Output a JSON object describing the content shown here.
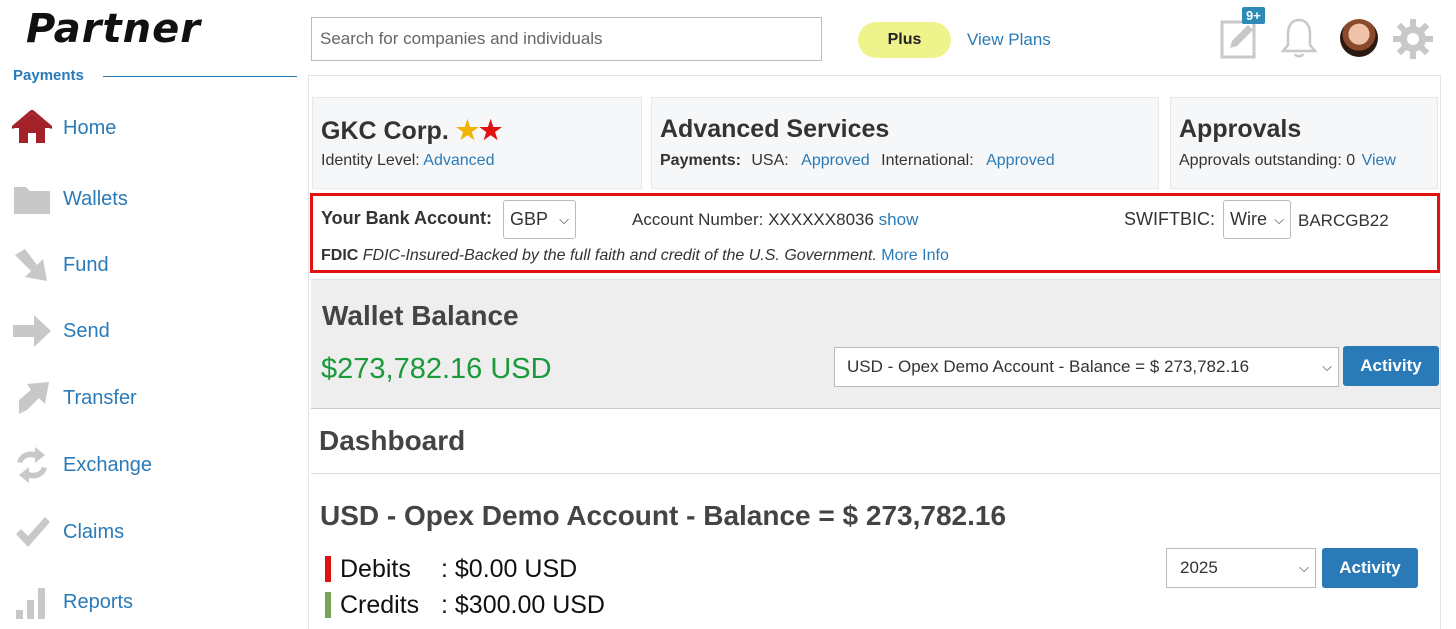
{
  "brand": {
    "logo_text": "Partner"
  },
  "sidebar": {
    "section_label": "Payments",
    "items": [
      {
        "label": "Home",
        "icon": "home-icon"
      },
      {
        "label": "Wallets",
        "icon": "folder-icon"
      },
      {
        "label": "Fund",
        "icon": "arrow-down-right-icon"
      },
      {
        "label": "Send",
        "icon": "arrow-right-icon"
      },
      {
        "label": "Transfer",
        "icon": "arrow-up-right-icon"
      },
      {
        "label": "Exchange",
        "icon": "exchange-icon"
      },
      {
        "label": "Claims",
        "icon": "checkmark-icon"
      },
      {
        "label": "Reports",
        "icon": "bar-chart-icon"
      }
    ]
  },
  "header": {
    "search_placeholder": "Search for companies and individuals",
    "plus_label": "Plus",
    "view_plans_label": "View Plans",
    "notes_badge": "9+"
  },
  "company_card": {
    "name": "GKC Corp.",
    "identity_label": "Identity Level:",
    "identity_value": "Advanced"
  },
  "services_card": {
    "title": "Advanced Services",
    "payments_label": "Payments:",
    "usa_label": "USA:",
    "usa_value": "Approved",
    "intl_label": "International:",
    "intl_value": "Approved"
  },
  "approvals_card": {
    "title": "Approvals",
    "outstanding_label": "Approvals outstanding: 0",
    "view_label": "View"
  },
  "bank_account": {
    "label": "Your Bank Account:",
    "currency": "GBP",
    "account_number_label": "Account Number:",
    "account_number": "XXXXXX8036",
    "show_label": "show",
    "swift_label": "SWIFTBIC:",
    "transfer_type": "Wire",
    "swift_code": "BARCGB22",
    "fdic_label": "FDIC",
    "fdic_text": "FDIC-Insured-Backed by the full faith and credit of the U.S. Government.",
    "more_info_label": "More Info"
  },
  "wallet_balance": {
    "title": "Wallet Balance",
    "amount": "$273,782.16 USD",
    "account_select": "USD - Opex Demo Account - Balance = $ 273,782.16",
    "activity_label": "Activity"
  },
  "dashboard": {
    "title": "Dashboard",
    "account_title": "USD - Opex Demo Account - Balance = $ 273,782.16",
    "debits_label": "Debits",
    "debits_value": ": $0.00 USD",
    "credits_label": "Credits",
    "credits_value": ": $300.00 USD",
    "year_select": "2025",
    "activity_label": "Activity"
  },
  "colors": {
    "link": "#2a7ab7",
    "balance_green": "#1a9a3a",
    "debit_red": "#e01212",
    "credit_green": "#7aa35a",
    "highlight_border": "#e01212",
    "plus_yellow": "#eff38c"
  }
}
